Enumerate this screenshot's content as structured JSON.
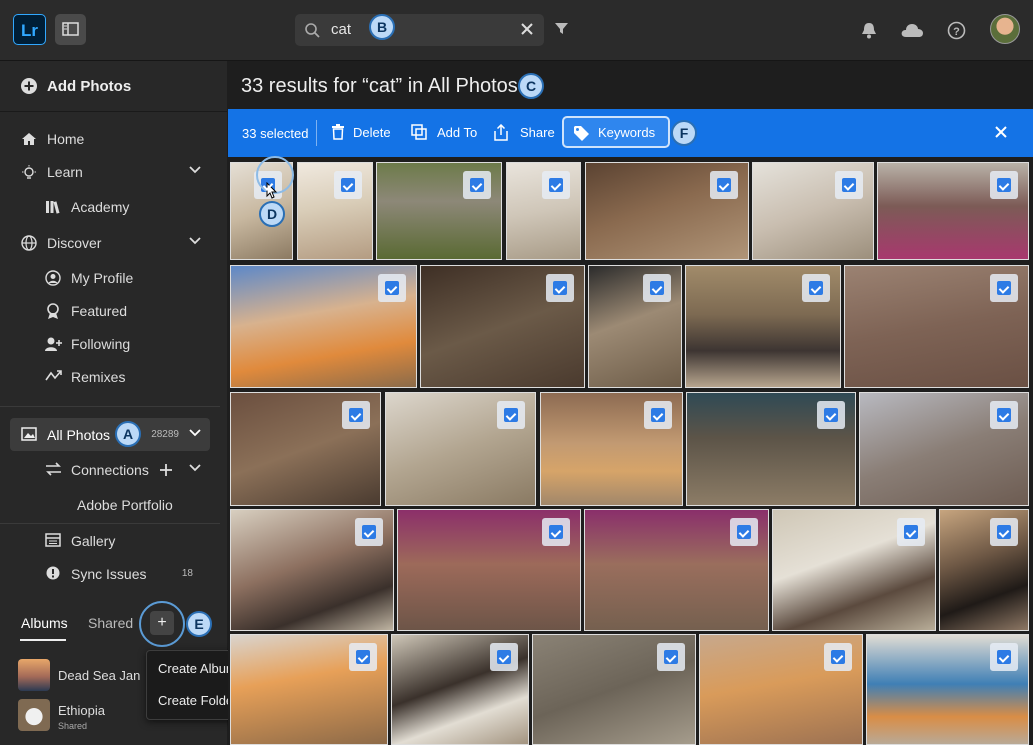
{
  "app": {
    "logo": "Lr"
  },
  "search": {
    "query": "cat"
  },
  "callouts": {
    "a": "A",
    "b": "B",
    "c": "C",
    "d": "D",
    "e": "E",
    "f": "F"
  },
  "sidebar": {
    "add_photos": "Add Photos",
    "items": [
      {
        "label": "Home",
        "icon": "home-icon"
      },
      {
        "label": "Learn",
        "icon": "lightbulb-icon"
      },
      {
        "label": "Academy",
        "icon": "books-icon"
      },
      {
        "label": "Discover",
        "icon": "globe-icon"
      },
      {
        "label": "My Profile",
        "icon": "profile-icon"
      },
      {
        "label": "Featured",
        "icon": "ribbon-icon"
      },
      {
        "label": "Following",
        "icon": "following-icon"
      },
      {
        "label": "Remixes",
        "icon": "remix-icon"
      }
    ],
    "all_photos": {
      "label": "All Photos",
      "count": "28289"
    },
    "connections": "Connections",
    "adobe_portfolio": "Adobe Portfolio",
    "gallery": "Gallery",
    "sync_issues": {
      "label": "Sync Issues",
      "count": "18"
    },
    "tabs": {
      "albums": "Albums",
      "shared": "Shared"
    },
    "add_symbol": "+",
    "albums": [
      {
        "name": "Dead Sea Jan",
        "sub": ""
      },
      {
        "name": "Ethiopia",
        "sub": "Shared"
      }
    ],
    "popup": {
      "create_album": "Create Album",
      "create_folder": "Create Folder"
    }
  },
  "main": {
    "results_title": "33 results for “cat” in All Photos",
    "actionbar": {
      "selected": "33 selected",
      "delete": "Delete",
      "add_to": "Add To",
      "share": "Share",
      "keywords": "Keywords"
    }
  },
  "colors": {
    "accent": "#1473e6",
    "background": "#1e1e1e",
    "sidebar": "#282828"
  }
}
